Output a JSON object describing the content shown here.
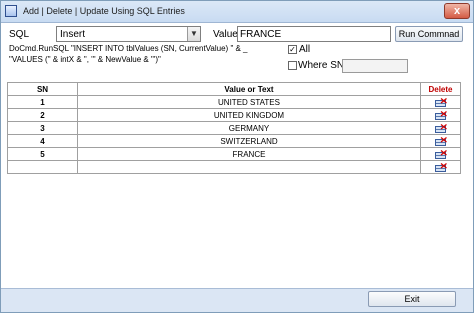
{
  "window": {
    "title": "Add | Delete | Update Using SQL Entries",
    "close_label": "x"
  },
  "form": {
    "sql_label": "SQL",
    "sql_value": "Insert",
    "value_label": "Value:",
    "value_text": "FRANCE",
    "run_button": "Run Commnad",
    "sql_statement_line1": "DoCmd.RunSQL \"INSERT INTO tblValues (SN, CurrentValue) \" & _",
    "sql_statement_line2": "\"VALUES (\" & intX & \", '\" & NewValue & \"')\"",
    "all_label": "All",
    "all_checked": true,
    "where_label": "Where SN=",
    "where_checked": false,
    "where_value": ""
  },
  "grid": {
    "headers": {
      "sn": "SN",
      "value": "Value or Text",
      "delete": "Delete"
    },
    "rows": [
      {
        "sn": "1",
        "value": "UNITED STATES"
      },
      {
        "sn": "2",
        "value": "UNITED KINGDOM"
      },
      {
        "sn": "3",
        "value": "GERMANY"
      },
      {
        "sn": "4",
        "value": "SWITZERLAND"
      },
      {
        "sn": "5",
        "value": "FRANCE"
      },
      {
        "sn": "",
        "value": ""
      }
    ]
  },
  "footer": {
    "exit_button": "Exit"
  }
}
